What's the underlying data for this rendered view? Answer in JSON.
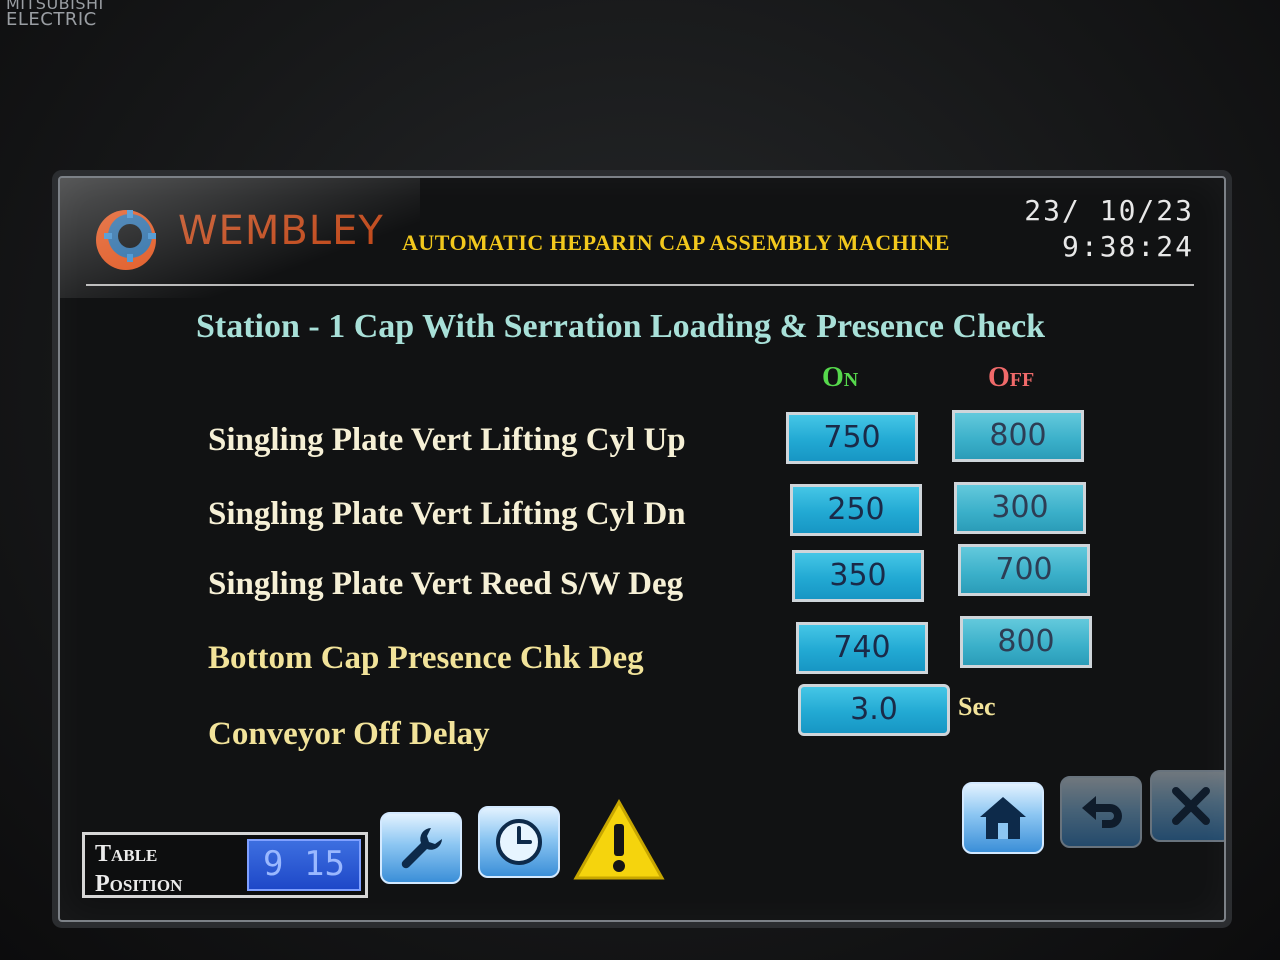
{
  "device": {
    "maker_line1": "MITSUBISHI",
    "maker_line2": "ELECTRIC"
  },
  "header": {
    "brand": "WEMBLEY",
    "machine_title": "AUTOMATIC HEPARIN CAP ASSEMBLY MACHINE",
    "date": "23/ 10/23",
    "time": "9:38:24"
  },
  "page": {
    "title": "Station - 1 Cap With Serration Loading & Presence Check",
    "col_on": "On",
    "col_off": "Off"
  },
  "params": [
    {
      "label": "Singling Plate Vert Lifting Cyl Up",
      "on": "750",
      "off": "800"
    },
    {
      "label": "Singling Plate Vert Lifting Cyl Dn",
      "on": "250",
      "off": "300"
    },
    {
      "label": "Singling Plate Vert Reed S/W Deg",
      "on": "350",
      "off": "700"
    },
    {
      "label": "Bottom Cap Presence Chk Deg",
      "on": "740",
      "off": "800"
    },
    {
      "label": "Conveyor Off Delay",
      "value": "3.0",
      "unit": "Sec"
    }
  ],
  "footer": {
    "table_position_label_1": "Table",
    "table_position_label_2": "Position",
    "table_position_value": "9 15"
  },
  "icons": {
    "settings": "wrench-icon",
    "timer": "clock-icon",
    "alarm": "warning-icon",
    "home": "home-icon",
    "back": "back-arrow-icon",
    "close": "close-icon"
  },
  "colors": {
    "title_yellow": "#f2c81d",
    "on_green": "#56d84c",
    "off_red": "#f06a6a",
    "value_cyan": "#22a9d3",
    "brand_orange": "#e0561f"
  }
}
